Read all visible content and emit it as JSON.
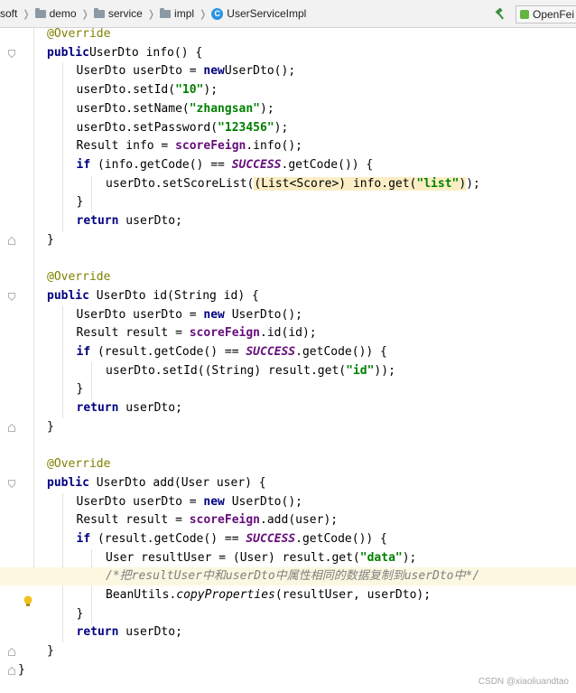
{
  "breadcrumb": {
    "items": [
      {
        "label": "soft",
        "icon": "folder-icon"
      },
      {
        "label": "demo",
        "icon": "folder-icon"
      },
      {
        "label": "service",
        "icon": "folder-icon"
      },
      {
        "label": "impl",
        "icon": "folder-icon"
      },
      {
        "label": "UserServiceImpl",
        "icon": "class-icon"
      }
    ],
    "class_icon_letter": "C"
  },
  "toolbar": {
    "build_icon": "hammer-icon",
    "run_config_label": "OpenFei"
  },
  "colors": {
    "keyword": "#000080",
    "annotation": "#808000",
    "string": "#008000",
    "field": "#660e7a",
    "comment": "#808080",
    "caret_line": "#fcf7e1",
    "highlight": "#fbeec5"
  },
  "code_lines": [
    [
      [
        "an",
        "@Override"
      ]
    ],
    [
      [
        "kw",
        "public"
      ],
      [
        "",
        "UserDto info() {"
      ]
    ],
    [
      [
        "",
        "UserDto userDto = "
      ],
      [
        "kw",
        "new"
      ],
      [
        "",
        "UserDto();"
      ]
    ],
    [
      [
        "",
        "userDto.setId("
      ],
      [
        "st",
        "\"10\""
      ],
      [
        "",
        ");"
      ]
    ],
    [
      [
        "",
        "userDto.setName("
      ],
      [
        "st",
        "\"zhangsan\""
      ],
      [
        "",
        ");"
      ]
    ],
    [
      [
        "",
        "userDto.setPassword("
      ],
      [
        "st",
        "\"123456\""
      ],
      [
        "",
        ");"
      ]
    ],
    [
      [
        "",
        "Result info = "
      ],
      [
        "fd",
        "scoreFeign"
      ],
      [
        "",
        ".info();"
      ]
    ],
    [
      [
        "kw",
        "if"
      ],
      [
        "",
        " (info.getCode() == "
      ],
      [
        "cs",
        "SUCCESS"
      ],
      [
        "",
        ".getCode()) {"
      ]
    ],
    [
      [
        "",
        "userDto.setScoreList("
      ],
      [
        "hl",
        "(List<Score>) info.get("
      ],
      [
        "hlst",
        "\"list\""
      ],
      [
        "hl",
        ")"
      ],
      [
        "",
        ");"
      ]
    ],
    [
      [
        "",
        "}"
      ]
    ],
    [
      [
        "kw",
        "return"
      ],
      [
        "",
        " userDto;"
      ]
    ],
    [
      [
        "",
        "}"
      ]
    ],
    [
      [
        "",
        ""
      ]
    ],
    [
      [
        "an",
        "@Override"
      ]
    ],
    [
      [
        "kw",
        "public"
      ],
      [
        "",
        " UserDto id(String id) {"
      ]
    ],
    [
      [
        "",
        "UserDto userDto = "
      ],
      [
        "kw",
        "new"
      ],
      [
        "",
        " UserDto();"
      ]
    ],
    [
      [
        "",
        "Result result = "
      ],
      [
        "fd",
        "scoreFeign"
      ],
      [
        "",
        ".id(id);"
      ]
    ],
    [
      [
        "kw",
        "if"
      ],
      [
        "",
        " (result.getCode() == "
      ],
      [
        "cs",
        "SUCCESS"
      ],
      [
        "",
        ".getCode()) {"
      ]
    ],
    [
      [
        "",
        "userDto.setId((String) result.get("
      ],
      [
        "st",
        "\"id\""
      ],
      [
        "",
        "));"
      ]
    ],
    [
      [
        "",
        "}"
      ]
    ],
    [
      [
        "kw",
        "return"
      ],
      [
        "",
        " userDto;"
      ]
    ],
    [
      [
        "",
        "}"
      ]
    ],
    [
      [
        "",
        ""
      ]
    ],
    [
      [
        "an",
        "@Override"
      ]
    ],
    [
      [
        "kw",
        "public"
      ],
      [
        "",
        " UserDto add(User user) {"
      ]
    ],
    [
      [
        "",
        "UserDto userDto = "
      ],
      [
        "kw",
        "new"
      ],
      [
        "",
        " UserDto();"
      ]
    ],
    [
      [
        "",
        "Result result = "
      ],
      [
        "fd",
        "scoreFeign"
      ],
      [
        "",
        ".add(user);"
      ]
    ],
    [
      [
        "kw",
        "if"
      ],
      [
        "",
        " (result.getCode() == "
      ],
      [
        "cs",
        "SUCCESS"
      ],
      [
        "",
        ".getCode()) {"
      ]
    ],
    [
      [
        "",
        "User resultUser = (User) result.get("
      ],
      [
        "st",
        "\"data\""
      ],
      [
        "",
        ");"
      ]
    ],
    [
      [
        "cm",
        "/*把resultUser中和userDto中属性相同的数据复制到userDto中*/"
      ]
    ],
    [
      [
        "",
        "BeanUtils."
      ],
      [
        "sm",
        "copyProperties"
      ],
      [
        "",
        "(resultUser, userDto);"
      ]
    ],
    [
      [
        "",
        "}"
      ]
    ],
    [
      [
        "kw",
        "return"
      ],
      [
        "",
        " userDto;"
      ]
    ],
    [
      [
        "",
        "}"
      ]
    ],
    [
      [
        "",
        "}"
      ]
    ]
  ],
  "gutter_icons": {
    "intention": "lightbulb-icon"
  },
  "watermark": "CSDN @xiaoliuandtao"
}
